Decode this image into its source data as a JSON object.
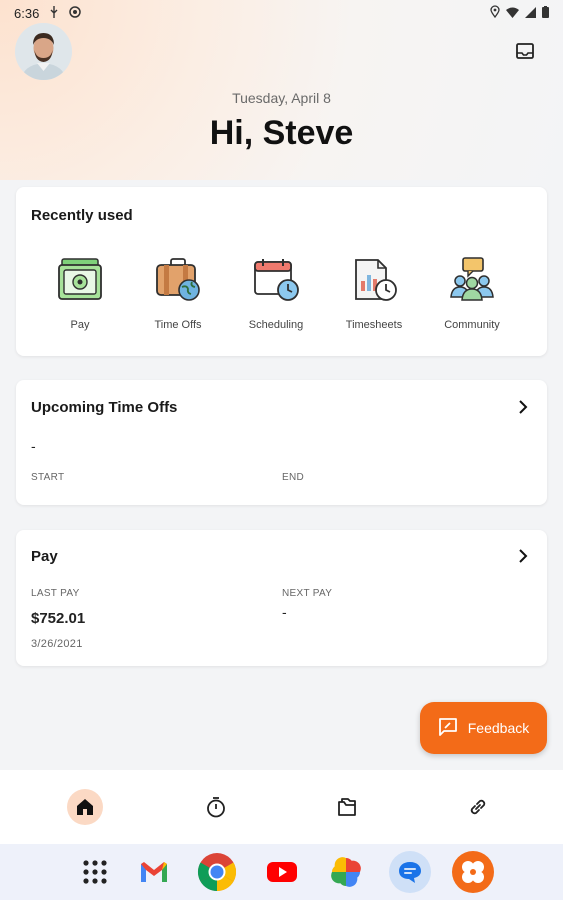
{
  "status_bar": {
    "time": "6:36"
  },
  "header": {
    "date": "Tuesday, April 8",
    "greeting": "Hi, Steve"
  },
  "recently_used": {
    "title": "Recently used",
    "items": [
      {
        "label": "Pay",
        "icon": "money-icon"
      },
      {
        "label": "Time Offs",
        "icon": "suitcase-globe-icon"
      },
      {
        "label": "Scheduling",
        "icon": "calendar-clock-icon"
      },
      {
        "label": "Timesheets",
        "icon": "document-clock-icon"
      },
      {
        "label": "Community",
        "icon": "people-chat-icon"
      }
    ]
  },
  "time_offs": {
    "title": "Upcoming Time Offs",
    "value": "-",
    "start_label": "START",
    "end_label": "END"
  },
  "pay": {
    "title": "Pay",
    "last_pay_label": "LAST PAY",
    "last_pay_amount": "$752.01",
    "last_pay_date": "3/26/2021",
    "next_pay_label": "NEXT PAY",
    "next_pay_value": "-"
  },
  "feedback_button": {
    "label": "Feedback"
  },
  "bottom_nav": [
    "home-icon",
    "timer-icon",
    "folders-icon",
    "link-icon"
  ],
  "colors": {
    "accent": "#f36b18",
    "home_active_bg": "#fbd9c4"
  }
}
